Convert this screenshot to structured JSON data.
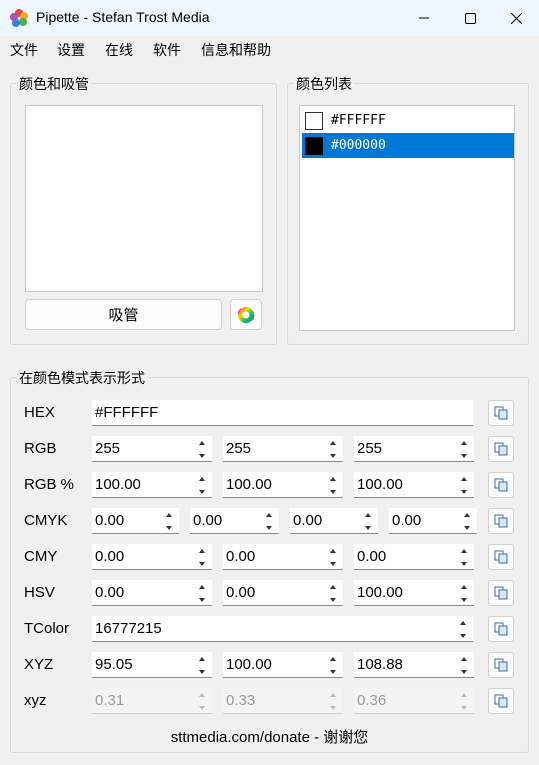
{
  "window": {
    "title": "Pipette - Stefan Trost Media"
  },
  "menu": [
    "文件",
    "设置",
    "在线",
    "软件",
    "信息和帮助"
  ],
  "groups": {
    "picker_title": "颜色和吸管",
    "list_title": "颜色列表",
    "modes_title": "在颜色模式表示形式"
  },
  "picker": {
    "button_label": "吸管"
  },
  "color_list": [
    {
      "label": "#FFFFFF",
      "color": "#FFFFFF"
    },
    {
      "label": "#000000",
      "color": "#000000"
    }
  ],
  "modes": {
    "hex": {
      "label": "HEX",
      "value": "#FFFFFF"
    },
    "rgb": {
      "label": "RGB",
      "values": [
        "255",
        "255",
        "255"
      ]
    },
    "rgb_pct": {
      "label": "RGB %",
      "values": [
        "100.00",
        "100.00",
        "100.00"
      ]
    },
    "cmyk": {
      "label": "CMYK",
      "values": [
        "0.00",
        "0.00",
        "0.00",
        "0.00"
      ]
    },
    "cmy": {
      "label": "CMY",
      "values": [
        "0.00",
        "0.00",
        "0.00"
      ]
    },
    "hsv": {
      "label": "HSV",
      "values": [
        "0.00",
        "0.00",
        "100.00"
      ]
    },
    "tcolor": {
      "label": "TColor",
      "value": "16777215"
    },
    "xyz": {
      "label": "XYZ",
      "values": [
        "95.05",
        "100.00",
        "108.88"
      ]
    },
    "xyz_small": {
      "label": "xyz",
      "values": [
        "0.31",
        "0.33",
        "0.36"
      ]
    }
  },
  "footer": "sttmedia.com/donate - 谢谢您"
}
